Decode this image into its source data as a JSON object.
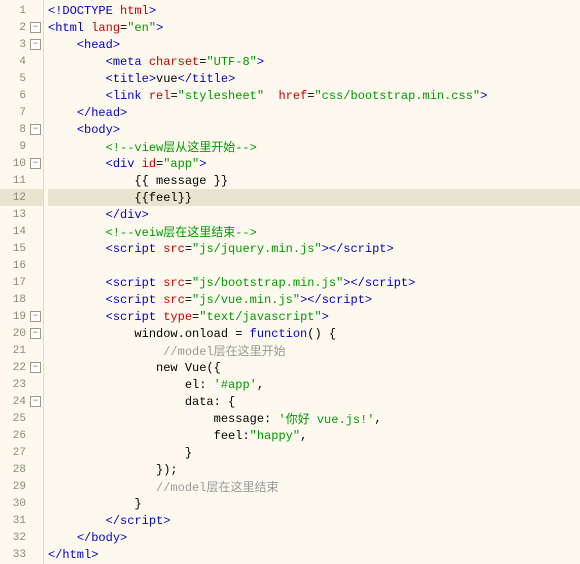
{
  "gutter": {
    "lines": [
      {
        "n": "1",
        "fold": null
      },
      {
        "n": "2",
        "fold": "-"
      },
      {
        "n": "3",
        "fold": "-"
      },
      {
        "n": "4",
        "fold": null
      },
      {
        "n": "5",
        "fold": null
      },
      {
        "n": "6",
        "fold": null
      },
      {
        "n": "7",
        "fold": null
      },
      {
        "n": "8",
        "fold": "-"
      },
      {
        "n": "9",
        "fold": null
      },
      {
        "n": "10",
        "fold": "-"
      },
      {
        "n": "11",
        "fold": null
      },
      {
        "n": "12",
        "fold": null,
        "hl": true
      },
      {
        "n": "13",
        "fold": null
      },
      {
        "n": "14",
        "fold": null
      },
      {
        "n": "15",
        "fold": null
      },
      {
        "n": "16",
        "fold": null
      },
      {
        "n": "17",
        "fold": null
      },
      {
        "n": "18",
        "fold": null
      },
      {
        "n": "19",
        "fold": "-"
      },
      {
        "n": "20",
        "fold": "-"
      },
      {
        "n": "21",
        "fold": null
      },
      {
        "n": "22",
        "fold": "-"
      },
      {
        "n": "23",
        "fold": null
      },
      {
        "n": "24",
        "fold": "-"
      },
      {
        "n": "25",
        "fold": null
      },
      {
        "n": "26",
        "fold": null
      },
      {
        "n": "27",
        "fold": null
      },
      {
        "n": "28",
        "fold": null
      },
      {
        "n": "29",
        "fold": null
      },
      {
        "n": "30",
        "fold": null
      },
      {
        "n": "31",
        "fold": null
      },
      {
        "n": "32",
        "fold": null
      },
      {
        "n": "33",
        "fold": null
      }
    ]
  },
  "code": {
    "l1": {
      "open": "<!",
      "tag": "DOCTYPE",
      "sp": " ",
      "attr": "html",
      "close": ">"
    },
    "l2": {
      "open": "<",
      "tag": "html",
      "sp": " ",
      "attr": "lang",
      "eq": "=",
      "val": "\"en\"",
      "close": ">"
    },
    "l3": {
      "indent": "    ",
      "open": "<",
      "tag": "head",
      "close": ">"
    },
    "l4": {
      "indent": "        ",
      "open": "<",
      "tag": "meta",
      "sp": " ",
      "attr": "charset",
      "eq": "=",
      "val": "\"UTF-8\"",
      "close": ">"
    },
    "l5": {
      "indent": "        ",
      "open": "<",
      "tag": "title",
      "close": ">",
      "text": "vue",
      "open2": "</",
      "tag2": "title",
      "close2": ">"
    },
    "l6": {
      "indent": "        ",
      "open": "<",
      "tag": "link",
      "sp": " ",
      "attr": "rel",
      "eq": "=",
      "val": "\"stylesheet\"",
      "sp2": "  ",
      "attr2": "href",
      "eq2": "=",
      "val2": "\"css/bootstrap.min.css\"",
      "close": ">"
    },
    "l7": {
      "indent": "    ",
      "open": "</",
      "tag": "head",
      "close": ">"
    },
    "l8": {
      "indent": "    ",
      "open": "<",
      "tag": "body",
      "close": ">"
    },
    "l9": {
      "indent": "        ",
      "comment": "<!--view层从这里开始-->"
    },
    "l10": {
      "indent": "        ",
      "open": "<",
      "tag": "div",
      "sp": " ",
      "attr": "id",
      "eq": "=",
      "val": "\"app\"",
      "close": ">"
    },
    "l11": {
      "indent": "            ",
      "text": "{{ message }}"
    },
    "l12": {
      "indent": "            ",
      "text": "{{feel}}"
    },
    "l13": {
      "indent": "        ",
      "open": "</",
      "tag": "div",
      "close": ">"
    },
    "l14": {
      "indent": "        ",
      "comment": "<!--veiw层在这里结束-->"
    },
    "l15": {
      "indent": "        ",
      "open": "<",
      "tag": "script",
      "sp": " ",
      "attr": "src",
      "eq": "=",
      "val": "\"js/jquery.min.js\"",
      "close": ">",
      "open2": "</",
      "tag2": "script",
      "close2": ">"
    },
    "l16": {
      "indent": ""
    },
    "l17": {
      "indent": "        ",
      "open": "<",
      "tag": "script",
      "sp": " ",
      "attr": "src",
      "eq": "=",
      "val": "\"js/bootstrap.min.js\"",
      "close": ">",
      "open2": "</",
      "tag2": "script",
      "close2": ">"
    },
    "l18": {
      "indent": "        ",
      "open": "<",
      "tag": "script",
      "sp": " ",
      "attr": "src",
      "eq": "=",
      "val": "\"js/vue.min.js\"",
      "close": ">",
      "open2": "</",
      "tag2": "script",
      "close2": ">"
    },
    "l19": {
      "indent": "        ",
      "open": "<",
      "tag": "script",
      "sp": " ",
      "attr": "type",
      "eq": "=",
      "val": "\"text/javascript\"",
      "close": ">"
    },
    "l20": {
      "indent": "            ",
      "js": "window.onload = ",
      "fn": "function",
      "js2": "() {"
    },
    "l21": {
      "indent": "                ",
      "jscomment": "//model层在这里开始"
    },
    "l22": {
      "indent": "               ",
      "js": "new Vue({"
    },
    "l23": {
      "indent": "                   ",
      "js": "el: ",
      "str": "'#app'",
      "js2": ","
    },
    "l24": {
      "indent": "                   ",
      "js": "data: {"
    },
    "l25": {
      "indent": "                       ",
      "js": "message: ",
      "str": "'你好 vue.js!'",
      "js2": ","
    },
    "l26": {
      "indent": "                       ",
      "js": "feel:",
      "str": "\"happy\"",
      "js2": ","
    },
    "l27": {
      "indent": "                   ",
      "js": "}"
    },
    "l28": {
      "indent": "               ",
      "js": "});"
    },
    "l29": {
      "indent": "               ",
      "jscomment": "//model层在这里结束"
    },
    "l30": {
      "indent": "            ",
      "js": "}"
    },
    "l31": {
      "indent": "        ",
      "open": "</",
      "tag": "script",
      "close": ">"
    },
    "l32": {
      "indent": "    ",
      "open": "</",
      "tag": "body",
      "close": ">"
    },
    "l33": {
      "open": "</",
      "tag": "html",
      "close": ">"
    }
  }
}
